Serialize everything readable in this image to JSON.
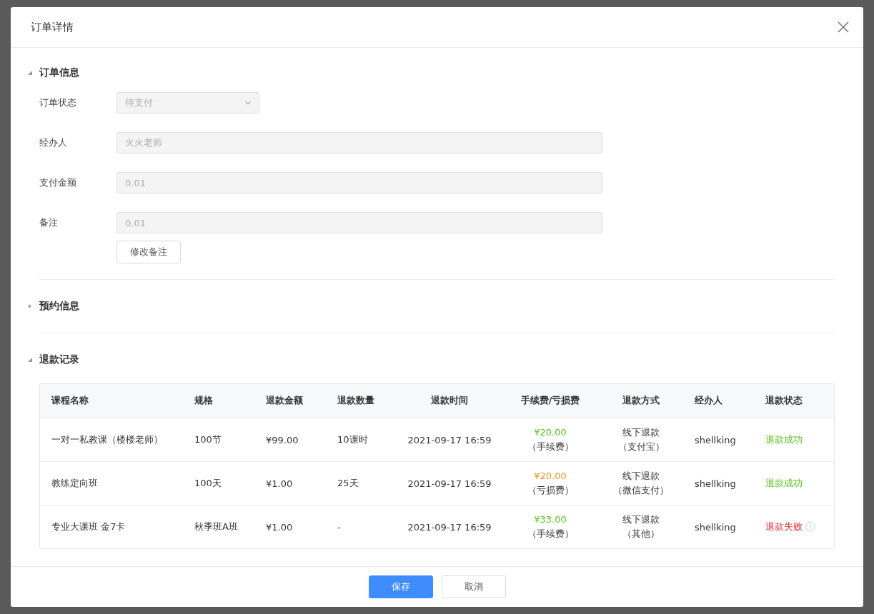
{
  "dialog": {
    "title": "订单详情"
  },
  "sections": [
    {
      "title": "订单信息",
      "expanded": true,
      "kind": "form"
    },
    {
      "title": "预约信息",
      "expanded": false
    },
    {
      "title": "退款记录",
      "expanded": true,
      "kind": "table"
    }
  ],
  "order_form": {
    "fields": [
      {
        "label": "订单状态",
        "kind": "select",
        "value": "待支付",
        "disabled": true
      },
      {
        "label": "经办人",
        "kind": "input",
        "value": "火火老师",
        "disabled": true
      },
      {
        "label": "支付金额",
        "kind": "input",
        "value": "0.01",
        "disabled": true
      },
      {
        "label": "备注",
        "kind": "input",
        "value": "0.01",
        "disabled": true
      }
    ],
    "edit_button": "修改备注"
  },
  "refund_table": {
    "columns": [
      "课程名称",
      "规格",
      "退款金额",
      "退款数量",
      "退款时间",
      "手续费/亏损费",
      "退款方式",
      "经办人",
      "退款状态"
    ],
    "rows": [
      {
        "course": "一对一私教课（楼楼老师）",
        "spec": "100节",
        "amount": "¥99.00",
        "quantity": "10课时",
        "time": "2021-09-17 16:59",
        "fee": {
          "amount": "¥20.00",
          "color": "#52c41a"
        },
        "fee_type": "（手续费）",
        "method": "线下退款",
        "channel": "（支付宝）",
        "handler": "shellking",
        "status": {
          "text": "退款成功",
          "kind": "success"
        }
      },
      {
        "course": "教练定向班",
        "spec": "100天",
        "amount": "¥1.00",
        "quantity": "25天",
        "time": "2021-09-17 16:59",
        "fee": {
          "amount": "¥20.00",
          "color": "#fa8c16"
        },
        "fee_type": "（亏损费）",
        "method": "线下退款",
        "channel": "（微信支付）",
        "handler": "shellking",
        "status": {
          "text": "退款成功",
          "kind": "success"
        }
      },
      {
        "course": "专业大课班 金7卡",
        "spec": "秋季班A班",
        "amount": "¥1.00",
        "quantity": "-",
        "time": "2021-09-17 16:59",
        "fee": {
          "amount": "¥33.00",
          "color": "#52c41a"
        },
        "fee_type": "（手续费）",
        "method": "线下退款",
        "channel": "（其他）",
        "handler": "shellking",
        "status": {
          "text": "退款失败",
          "kind": "failed"
        }
      }
    ]
  },
  "footer": {
    "buttons": [
      {
        "label": "保存",
        "kind": "primary"
      },
      {
        "label": "取消",
        "kind": "default"
      }
    ]
  }
}
